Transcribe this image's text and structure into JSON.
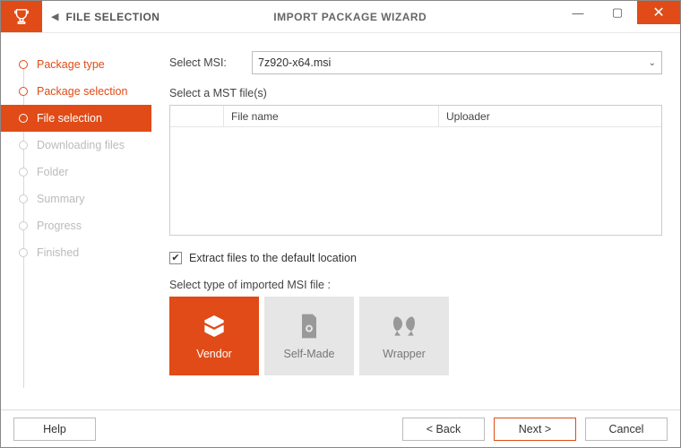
{
  "titlebar": {
    "step_label": "FILE SELECTION",
    "wizard_title": "IMPORT PACKAGE WIZARD"
  },
  "steps": [
    {
      "label": "Package type",
      "state": "done"
    },
    {
      "label": "Package selection",
      "state": "done"
    },
    {
      "label": "File selection",
      "state": "active"
    },
    {
      "label": "Downloading files",
      "state": "pending"
    },
    {
      "label": "Folder",
      "state": "pending"
    },
    {
      "label": "Summary",
      "state": "pending"
    },
    {
      "label": "Progress",
      "state": "pending"
    },
    {
      "label": "Finished",
      "state": "pending"
    }
  ],
  "content": {
    "select_msi_label": "Select MSI:",
    "select_msi_value": "7z920-x64.msi",
    "mst_label": "Select a MST file(s)",
    "mst_columns": {
      "c0": "",
      "c1": "File name",
      "c2": "Uploader"
    },
    "extract_checkbox": {
      "checked": true,
      "label": "Extract files to the default location"
    },
    "type_label": "Select type of imported MSI file :",
    "types": [
      {
        "label": "Vendor",
        "active": true
      },
      {
        "label": "Self-Made",
        "active": false
      },
      {
        "label": "Wrapper",
        "active": false
      }
    ]
  },
  "footer": {
    "help": "Help",
    "back": "<  Back",
    "next": "Next  >",
    "cancel": "Cancel"
  }
}
